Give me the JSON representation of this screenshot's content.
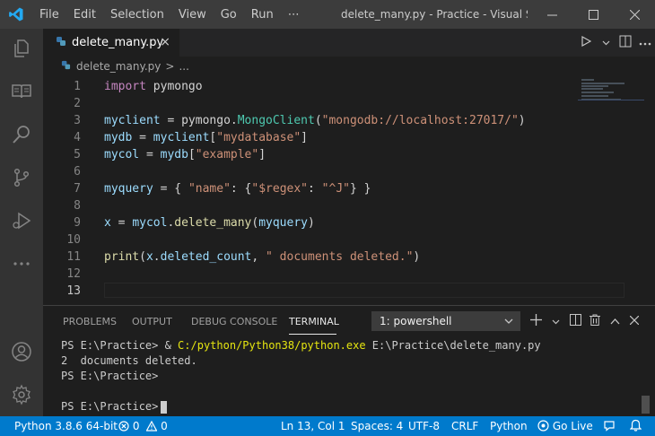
{
  "titlebar": {
    "menu": [
      "File",
      "Edit",
      "Selection",
      "View",
      "Go",
      "Run",
      "⋯"
    ],
    "title": "delete_many.py - Practice - Visual Stu..."
  },
  "tab": {
    "label": "delete_many.py",
    "close": "×"
  },
  "breadcrumb": {
    "file": "delete_many.py",
    "sep": ">",
    "rest": "..."
  },
  "lines": [
    {
      "n": "1",
      "tokens": [
        {
          "c": "kw",
          "t": "import"
        },
        {
          "c": "pl",
          "t": " pymongo"
        }
      ]
    },
    {
      "n": "2",
      "tokens": []
    },
    {
      "n": "3",
      "tokens": [
        {
          "c": "var",
          "t": "myclient"
        },
        {
          "c": "pl",
          "t": " = pymongo."
        },
        {
          "c": "cls",
          "t": "MongoClient"
        },
        {
          "c": "pl",
          "t": "("
        },
        {
          "c": "str",
          "t": "\"mongodb://localhost:27017/\""
        },
        {
          "c": "pl",
          "t": ")"
        }
      ]
    },
    {
      "n": "4",
      "tokens": [
        {
          "c": "var",
          "t": "mydb"
        },
        {
          "c": "pl",
          "t": " = "
        },
        {
          "c": "var",
          "t": "myclient"
        },
        {
          "c": "pl",
          "t": "["
        },
        {
          "c": "str",
          "t": "\"mydatabase\""
        },
        {
          "c": "pl",
          "t": "]"
        }
      ]
    },
    {
      "n": "5",
      "tokens": [
        {
          "c": "var",
          "t": "mycol"
        },
        {
          "c": "pl",
          "t": " = "
        },
        {
          "c": "var",
          "t": "mydb"
        },
        {
          "c": "pl",
          "t": "["
        },
        {
          "c": "str",
          "t": "\"example\""
        },
        {
          "c": "pl",
          "t": "]"
        }
      ]
    },
    {
      "n": "6",
      "tokens": []
    },
    {
      "n": "7",
      "tokens": [
        {
          "c": "var",
          "t": "myquery"
        },
        {
          "c": "pl",
          "t": " = { "
        },
        {
          "c": "str",
          "t": "\"name\""
        },
        {
          "c": "pl",
          "t": ": {"
        },
        {
          "c": "str",
          "t": "\"$regex\""
        },
        {
          "c": "pl",
          "t": ": "
        },
        {
          "c": "str",
          "t": "\"^J\""
        },
        {
          "c": "pl",
          "t": "} }"
        }
      ]
    },
    {
      "n": "8",
      "tokens": []
    },
    {
      "n": "9",
      "tokens": [
        {
          "c": "var",
          "t": "x"
        },
        {
          "c": "pl",
          "t": " = "
        },
        {
          "c": "var",
          "t": "mycol"
        },
        {
          "c": "pl",
          "t": "."
        },
        {
          "c": "fn",
          "t": "delete_many"
        },
        {
          "c": "pl",
          "t": "("
        },
        {
          "c": "var",
          "t": "myquery"
        },
        {
          "c": "pl",
          "t": ")"
        }
      ]
    },
    {
      "n": "10",
      "tokens": []
    },
    {
      "n": "11",
      "tokens": [
        {
          "c": "fn",
          "t": "print"
        },
        {
          "c": "pl",
          "t": "("
        },
        {
          "c": "var",
          "t": "x"
        },
        {
          "c": "pl",
          "t": "."
        },
        {
          "c": "var",
          "t": "deleted_count"
        },
        {
          "c": "pl",
          "t": ", "
        },
        {
          "c": "str",
          "t": "\" documents deleted.\""
        },
        {
          "c": "pl",
          "t": ")"
        }
      ]
    },
    {
      "n": "12",
      "tokens": []
    },
    {
      "n": "13",
      "tokens": []
    }
  ],
  "panel": {
    "tabs": [
      "PROBLEMS",
      "OUTPUT",
      "DEBUG CONSOLE",
      "TERMINAL"
    ],
    "shell": "1: powershell",
    "shell_chevron": "⌄",
    "actions": [
      "+",
      "⌄",
      "◫",
      " ",
      "^",
      "×"
    ]
  },
  "terminal": {
    "line1_prompt": "PS E:\\Practice> ",
    "line1_amp": "& ",
    "line1_exe": "C:/python/Python38/python.exe",
    "line1_arg": " E:\\Practice\\delete_many.py",
    "line2": "2  documents deleted.",
    "line3": "PS E:\\Practice>",
    "line4": "",
    "line5": "PS E:\\Practice>"
  },
  "status": {
    "python": "Python 3.8.6 64-bit",
    "errors": "0",
    "warnings": "0",
    "position": "Ln 13, Col 1",
    "spaces": "Spaces: 4",
    "encoding": "UTF-8",
    "eol": "CRLF",
    "language": "Python",
    "golive": "Go Live"
  },
  "colors": {
    "statusbar": "#007acc",
    "titlebar": "#3c3c3c",
    "editor": "#1e1e1e",
    "activity": "#333333"
  }
}
